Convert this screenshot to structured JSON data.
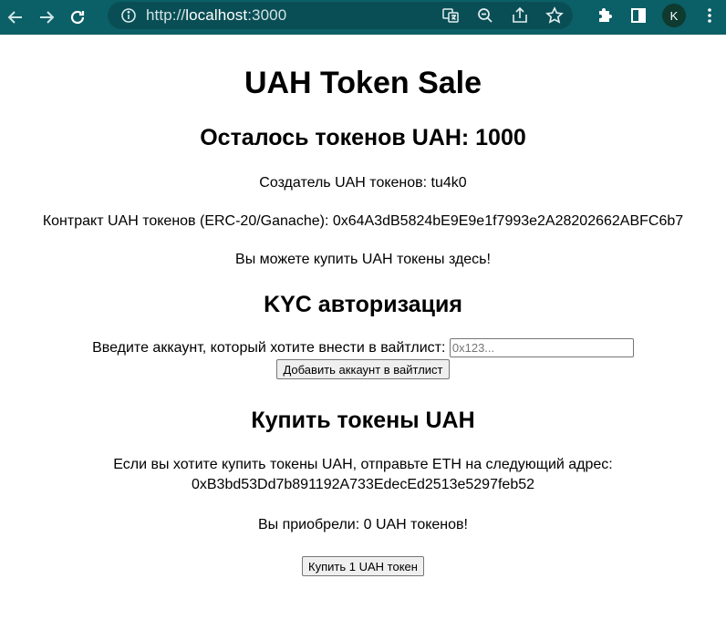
{
  "browser": {
    "url_scheme": "http://",
    "url_host": "localhost",
    "url_port": ":3000",
    "profile_initial": "K"
  },
  "page": {
    "title": "UAH Token Sale",
    "tokens_remaining": "Осталось токенов UAH: 1000",
    "creator": "Создатель UAH токенов: tu4k0",
    "contract": "Контракт UAH токенов (ERC-20/Ganache): 0x64A3dB5824bE9E9e1f7993e2A28202662ABFC6b7",
    "buy_here": "Вы можете купить UAH токены здесь!",
    "kyc": {
      "heading": "KYC авторизация",
      "label": "Введите аккаунт, который хотите внести в вайтлист:",
      "input_placeholder": "0x123...",
      "button_label": "Добавить аккаунт в вайтлист"
    },
    "buy": {
      "heading": "Купить токены UAH",
      "instruction": "Если вы хотите купить токены UAH, отправьте ETH на следующий адрес:",
      "address": "0xB3bd53Dd7b891192A733EdecEd2513e5297feb52",
      "bought": "Вы приобрели: 0 UAH токенов!",
      "button_label": "Купить 1 UAH токен"
    }
  },
  "icons": {
    "back": "back-arrow-icon",
    "forward": "forward-arrow-icon",
    "reload": "reload-icon",
    "site_info": "info-icon",
    "translate": "translate-icon",
    "zoom": "zoom-out-icon",
    "share": "share-icon",
    "bookmark": "star-icon",
    "extensions": "puzzle-icon",
    "side_panel": "side-panel-icon",
    "menu": "kebab-menu-icon"
  },
  "colors": {
    "toolbar": "#0b5f66",
    "omnibox": "#0a4e55",
    "avatar": "#0f3a2f"
  }
}
